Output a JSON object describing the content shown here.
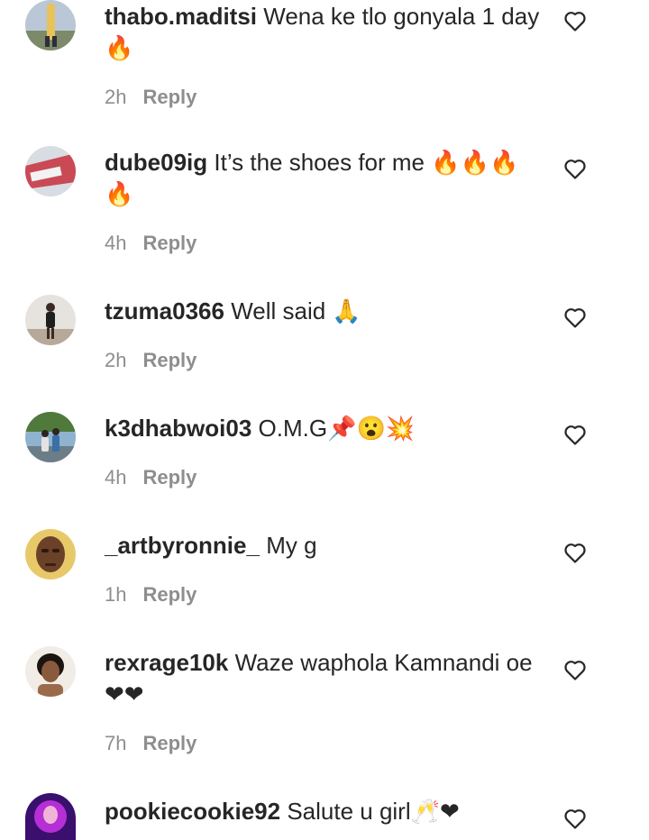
{
  "comments": [
    {
      "username": "thabo.maditsi",
      "text": "Wena ke tlo gonyala 1 day🔥",
      "time": "2h",
      "reply": "Reply"
    },
    {
      "username": "dube09ig",
      "text": "It’s the shoes for me 🔥🔥🔥🔥",
      "time": "4h",
      "reply": "Reply"
    },
    {
      "username": "tzuma0366",
      "text": "Well said 🙏",
      "time": "2h",
      "reply": "Reply"
    },
    {
      "username": "k3dhabwoi03",
      "text": "O.M.G📌😮💥",
      "time": "4h",
      "reply": "Reply"
    },
    {
      "username": "_artbyronnie_",
      "text": "My g",
      "time": "1h",
      "reply": "Reply"
    },
    {
      "username": "rexrage10k",
      "text": "Waze waphola Kamnandi oe ❤❤",
      "time": "7h",
      "reply": "Reply"
    },
    {
      "username": "pookiecookie92",
      "text": "Salute u girl🥂❤",
      "time": "",
      "reply": ""
    }
  ],
  "icons": {
    "like": "heart-outline-icon"
  },
  "colors": {
    "text": "#262626",
    "secondary": "#8e8e8e"
  }
}
